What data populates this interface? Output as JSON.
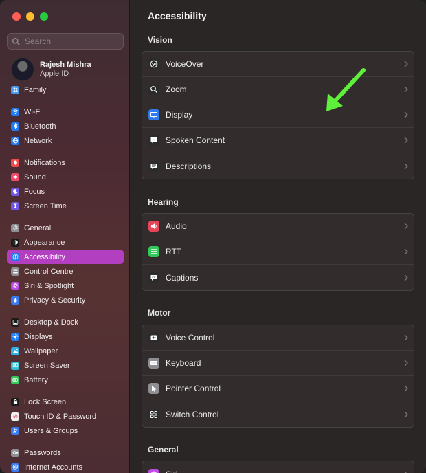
{
  "window": {
    "title": "Accessibility"
  },
  "search": {
    "placeholder": "Search"
  },
  "account": {
    "name": "Rajesh Mishra",
    "subtitle": "Apple ID"
  },
  "sidebar": {
    "items": [
      {
        "label": "Family",
        "icon": "family-icon",
        "color": "#4a9bf0"
      },
      {
        "label": "Wi-Fi",
        "icon": "wifi-icon",
        "color": "#1f7cf5",
        "gap_before": true
      },
      {
        "label": "Bluetooth",
        "icon": "bluetooth-icon",
        "color": "#1f7cf5"
      },
      {
        "label": "Network",
        "icon": "network-icon",
        "color": "#1f7cf5"
      },
      {
        "label": "Notifications",
        "icon": "bell-icon",
        "color": "#f04a4a",
        "gap_before": true
      },
      {
        "label": "Sound",
        "icon": "speaker-icon",
        "color": "#f04a6a"
      },
      {
        "label": "Focus",
        "icon": "moon-icon",
        "color": "#6e5ae6"
      },
      {
        "label": "Screen Time",
        "icon": "hourglass-icon",
        "color": "#6e5ae6"
      },
      {
        "label": "General",
        "icon": "gear-icon",
        "color": "#8e8e93",
        "gap_before": true
      },
      {
        "label": "Appearance",
        "icon": "appearance-icon",
        "color": "#1a1a1a"
      },
      {
        "label": "Accessibility",
        "icon": "accessibility-icon",
        "color": "#1f7cf5",
        "active": true
      },
      {
        "label": "Control Centre",
        "icon": "control-centre-icon",
        "color": "#8e8e93"
      },
      {
        "label": "Siri & Spotlight",
        "icon": "siri-icon",
        "color": "#c04ae6"
      },
      {
        "label": "Privacy & Security",
        "icon": "hand-icon",
        "color": "#3a7bf0"
      },
      {
        "label": "Desktop & Dock",
        "icon": "dock-icon",
        "color": "#1a1a1a",
        "gap_before": true
      },
      {
        "label": "Displays",
        "icon": "sun-icon",
        "color": "#1f7cf5"
      },
      {
        "label": "Wallpaper",
        "icon": "wallpaper-icon",
        "color": "#30b0e6"
      },
      {
        "label": "Screen Saver",
        "icon": "screensaver-icon",
        "color": "#30c0d6"
      },
      {
        "label": "Battery",
        "icon": "battery-icon",
        "color": "#34c759"
      },
      {
        "label": "Lock Screen",
        "icon": "lock-icon",
        "color": "#1a1a1a",
        "gap_before": true
      },
      {
        "label": "Touch ID & Password",
        "icon": "fingerprint-icon",
        "color": "#f0f0f0"
      },
      {
        "label": "Users & Groups",
        "icon": "users-icon",
        "color": "#3a7bf0"
      },
      {
        "label": "Passwords",
        "icon": "key-icon",
        "color": "#8e8e93",
        "gap_before": true
      },
      {
        "label": "Internet Accounts",
        "icon": "at-icon",
        "color": "#3a7bf0"
      }
    ]
  },
  "sections": {
    "vision": {
      "heading": "Vision",
      "rows": [
        {
          "label": "VoiceOver",
          "icon": "voiceover-icon",
          "color": "#2b2b2b"
        },
        {
          "label": "Zoom",
          "icon": "zoom-icon",
          "color": "#2b2b2b"
        },
        {
          "label": "Display",
          "icon": "display-icon",
          "color": "#2f7cf0"
        },
        {
          "label": "Spoken Content",
          "icon": "speech-bubble-icon",
          "color": "#2b2b2b"
        },
        {
          "label": "Descriptions",
          "icon": "descriptions-icon",
          "color": "#2b2b2b"
        }
      ]
    },
    "hearing": {
      "heading": "Hearing",
      "rows": [
        {
          "label": "Audio",
          "icon": "speaker-icon",
          "color": "#e8445a"
        },
        {
          "label": "RTT",
          "icon": "keypad-icon",
          "color": "#34c759"
        },
        {
          "label": "Captions",
          "icon": "captions-icon",
          "color": "#2b2b2b"
        }
      ]
    },
    "motor": {
      "heading": "Motor",
      "rows": [
        {
          "label": "Voice Control",
          "icon": "voice-control-icon",
          "color": "#2b2b2b"
        },
        {
          "label": "Keyboard",
          "icon": "keyboard-icon",
          "color": "#8e8e93"
        },
        {
          "label": "Pointer Control",
          "icon": "pointer-icon",
          "color": "#8e8e93"
        },
        {
          "label": "Switch Control",
          "icon": "switch-control-icon",
          "color": "#2b2b2b"
        }
      ]
    },
    "general": {
      "heading": "General",
      "rows": [
        {
          "label": "Siri",
          "icon": "siri-icon",
          "color": "#c04ae6"
        }
      ]
    }
  },
  "annotation": {
    "arrow_color": "#5ef03a"
  }
}
